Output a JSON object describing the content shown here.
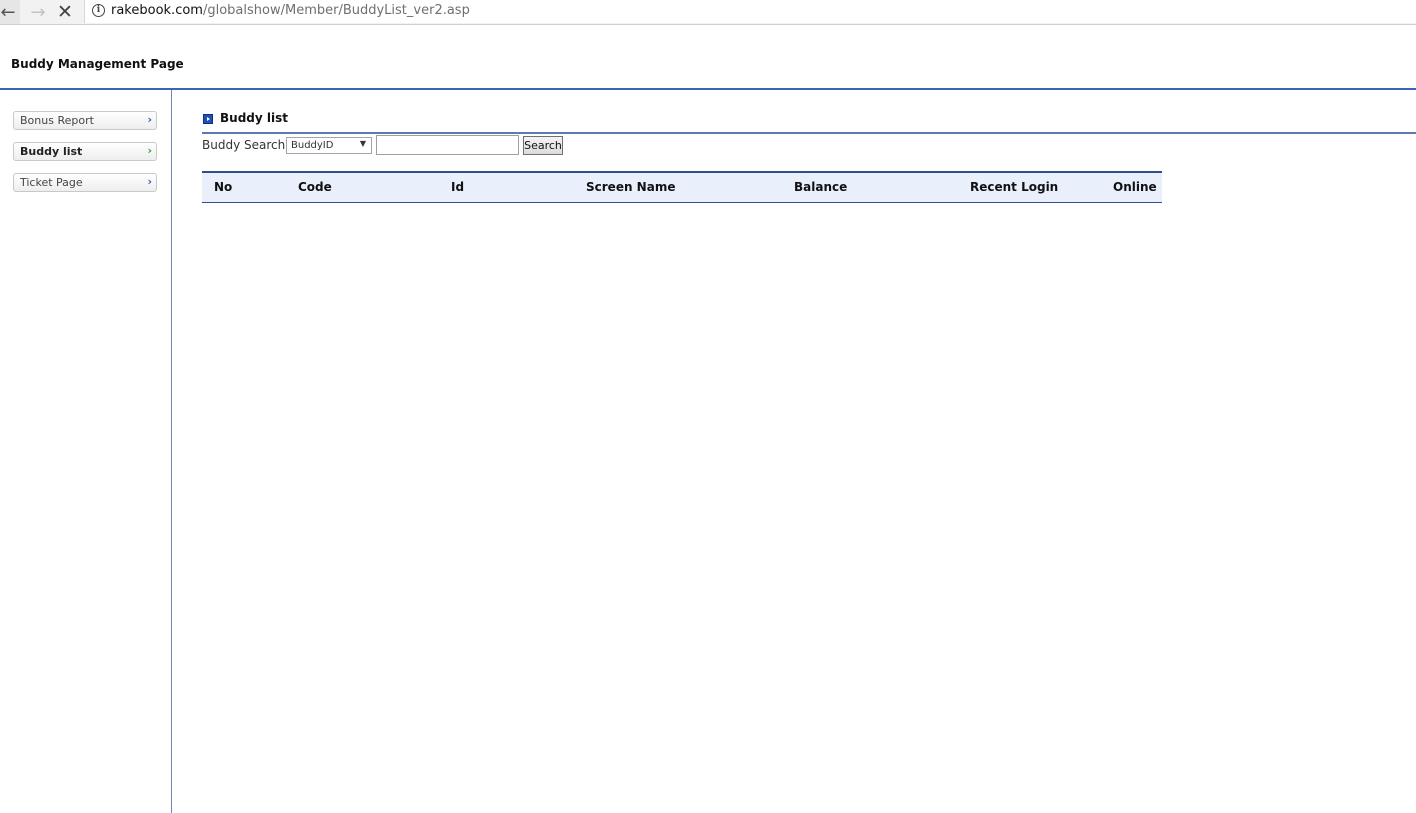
{
  "browser": {
    "url_domain": "rakebook.com",
    "url_path": "/globalshow/Member/BuddyList_ver2.asp",
    "back_icon": "←",
    "forward_icon": "→",
    "stop_icon": "✕",
    "info_icon": "i"
  },
  "header": {
    "title": "Buddy Management Page"
  },
  "sidebar": {
    "items": [
      {
        "label": "Bonus Report",
        "chevron": "›"
      },
      {
        "label": "Buddy list",
        "chevron": "›"
      },
      {
        "label": "Ticket Page",
        "chevron": "›"
      }
    ]
  },
  "main": {
    "section_title": "Buddy list",
    "search": {
      "label": "Buddy Search :",
      "select_value": "BuddyID",
      "select_arrow": "▼",
      "input_value": "",
      "button_label": "Search"
    },
    "table": {
      "columns": [
        "No",
        "Code",
        "Id",
        "Screen Name",
        "Balance",
        "Recent Login",
        "Online"
      ]
    }
  }
}
